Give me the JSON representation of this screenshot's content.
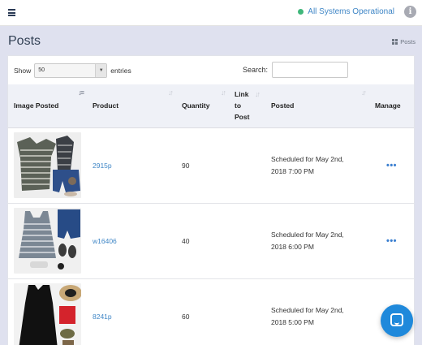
{
  "nav": {
    "status_text": "All Systems Operational",
    "status_color": "#3fb77a",
    "info_icon": "i"
  },
  "page": {
    "title": "Posts",
    "breadcrumb": "Posts"
  },
  "table_controls": {
    "show_label": "Show",
    "entries_value": "50",
    "entries_label": "entries",
    "search_label": "Search:",
    "search_value": ""
  },
  "columns": [
    "Image Posted",
    "Product",
    "Quantity",
    "Link to Post",
    "Posted",
    "Manage"
  ],
  "rows": [
    {
      "product": "2915p",
      "quantity": "90",
      "posted_line1": "Scheduled for May 2nd,",
      "posted_line2": "2018 7:00 PM",
      "manage": "•••"
    },
    {
      "product": "w16406",
      "quantity": "40",
      "posted_line1": "Scheduled for May 2nd,",
      "posted_line2": "2018 6:00 PM",
      "manage": "•••"
    },
    {
      "product": "8241p",
      "quantity": "60",
      "posted_line1": "Scheduled for May 2nd,",
      "posted_line2": "2018 5:00 PM",
      "manage": "•••"
    }
  ],
  "colors": {
    "link": "#3f86c6",
    "chat": "#1f89db"
  }
}
